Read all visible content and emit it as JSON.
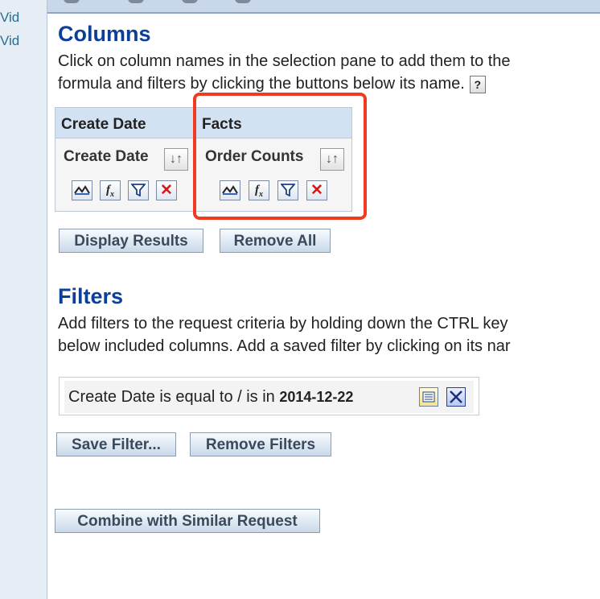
{
  "left_pane": {
    "link_fragments": [
      "Vid",
      "Vid"
    ]
  },
  "columns": {
    "title": "Columns",
    "description_line1": "Click on column names in the selection pane to add them to the",
    "description_line2": "formula and filters by clicking the buttons below its name.",
    "help_icon_glyph": "?",
    "table": [
      {
        "header": "Create Date",
        "column_name": "Create Date",
        "sort_glyph": "↓↑"
      },
      {
        "header": "Facts",
        "column_name": "Order Counts",
        "sort_glyph": "↓↑"
      }
    ],
    "icons": [
      "properties-icon",
      "formula-icon",
      "filter-icon",
      "delete-icon"
    ]
  },
  "buttons": {
    "display_results": "Display Results",
    "remove_all": "Remove All",
    "save_filter": "Save Filter...",
    "remove_filters": "Remove Filters",
    "combine": "Combine with Similar Request"
  },
  "filters": {
    "title": "Filters",
    "description_line1": "Add filters to the request criteria by holding down the CTRL key",
    "description_line2": "below included columns. Add a saved filter by clicking on its nar",
    "filter_text": "Create Date is equal to / is in",
    "filter_value": "2014-12-22"
  },
  "colors": {
    "heading": "#0b3f98",
    "highlight": "#f03a22",
    "header_bg": "#d3e2f3"
  }
}
